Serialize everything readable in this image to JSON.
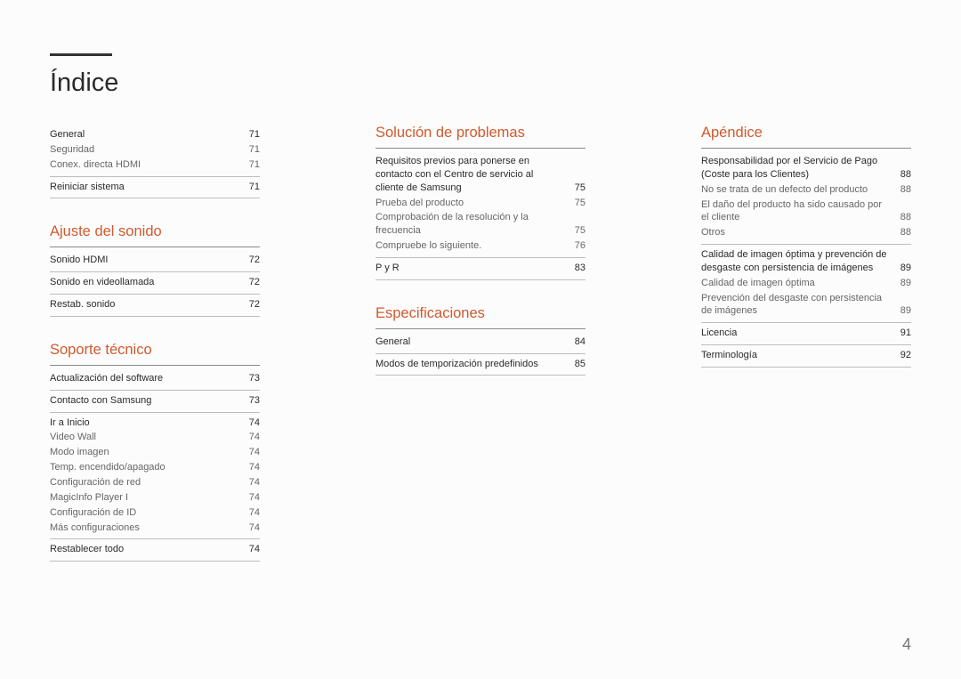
{
  "title": "Índice",
  "page_number": "4",
  "columns": [
    {
      "sections": [
        {
          "heading": null,
          "groups": [
            {
              "rows": [
                {
                  "label": "General",
                  "pg": "71",
                  "main": true
                },
                {
                  "label": "Seguridad",
                  "pg": "71"
                },
                {
                  "label": "Conex. directa HDMI",
                  "pg": "71"
                }
              ]
            },
            {
              "rows": [
                {
                  "label": "Reiniciar sistema",
                  "pg": "71",
                  "main": true
                }
              ]
            }
          ]
        },
        {
          "heading": "Ajuste del sonido",
          "groups": [
            {
              "rows": [
                {
                  "label": "Sonido HDMI",
                  "pg": "72",
                  "main": true
                }
              ]
            },
            {
              "rows": [
                {
                  "label": "Sonido en videollamada",
                  "pg": "72",
                  "main": true
                }
              ]
            },
            {
              "rows": [
                {
                  "label": "Restab. sonido",
                  "pg": "72",
                  "main": true
                }
              ]
            }
          ]
        },
        {
          "heading": "Soporte técnico",
          "groups": [
            {
              "rows": [
                {
                  "label": "Actualización del software",
                  "pg": "73",
                  "main": true
                }
              ]
            },
            {
              "rows": [
                {
                  "label": "Contacto con Samsung",
                  "pg": "73",
                  "main": true
                }
              ]
            },
            {
              "rows": [
                {
                  "label": "Ir a Inicio",
                  "pg": "74",
                  "main": true
                },
                {
                  "label": "Video Wall",
                  "pg": "74"
                },
                {
                  "label": "Modo imagen",
                  "pg": "74"
                },
                {
                  "label": "Temp. encendido/apagado",
                  "pg": "74"
                },
                {
                  "label": "Configuración de red",
                  "pg": "74"
                },
                {
                  "label": "MagicInfo Player I",
                  "pg": "74"
                },
                {
                  "label": "Configuración de ID",
                  "pg": "74"
                },
                {
                  "label": "Más configuraciones",
                  "pg": "74"
                }
              ]
            },
            {
              "rows": [
                {
                  "label": "Restablecer todo",
                  "pg": "74",
                  "main": true
                }
              ]
            }
          ]
        }
      ]
    },
    {
      "sections": [
        {
          "heading": "Solución de problemas",
          "groups": [
            {
              "rows": [
                {
                  "label": "Requisitos previos para ponerse en contacto con el Centro de servicio al cliente de Samsung",
                  "pg": "75",
                  "main": true
                },
                {
                  "label": "Prueba del producto",
                  "pg": "75"
                },
                {
                  "label": "Comprobación de la resolución y la frecuencia",
                  "pg": "75"
                },
                {
                  "label": "Compruebe lo siguiente.",
                  "pg": "76"
                }
              ]
            },
            {
              "rows": [
                {
                  "label": "P y R",
                  "pg": "83",
                  "main": true
                }
              ]
            }
          ]
        },
        {
          "heading": "Especificaciones",
          "groups": [
            {
              "rows": [
                {
                  "label": "General",
                  "pg": "84",
                  "main": true
                }
              ]
            },
            {
              "rows": [
                {
                  "label": "Modos de temporización predefinidos",
                  "pg": "85",
                  "main": true
                }
              ]
            }
          ]
        }
      ]
    },
    {
      "sections": [
        {
          "heading": "Apéndice",
          "groups": [
            {
              "rows": [
                {
                  "label": "Responsabilidad por el Servicio de Pago (Coste para los Clientes)",
                  "pg": "88",
                  "main": true
                },
                {
                  "label": "No se trata de un defecto del producto",
                  "pg": "88"
                },
                {
                  "label": "El daño del producto ha sido causado por el cliente",
                  "pg": "88"
                },
                {
                  "label": "Otros",
                  "pg": "88"
                }
              ]
            },
            {
              "rows": [
                {
                  "label": "Calidad de imagen óptima y prevención de desgaste con persistencia de imágenes",
                  "pg": "89",
                  "main": true
                },
                {
                  "label": "Calidad de imagen óptima",
                  "pg": "89"
                },
                {
                  "label": "Prevención del desgaste con persistencia de imágenes",
                  "pg": "89"
                }
              ]
            },
            {
              "rows": [
                {
                  "label": "Licencia",
                  "pg": "91",
                  "main": true
                }
              ]
            },
            {
              "rows": [
                {
                  "label": "Terminología",
                  "pg": "92",
                  "main": true
                }
              ]
            }
          ]
        }
      ]
    }
  ]
}
